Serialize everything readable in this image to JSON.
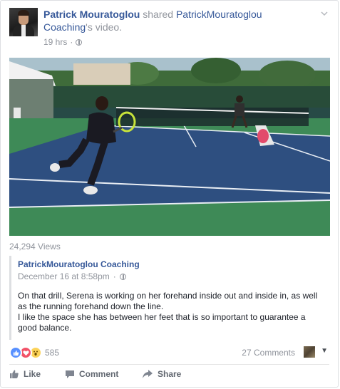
{
  "post": {
    "author": "Patrick Mouratoglou",
    "action_text": " shared ",
    "shared_page": "PatrickMouratoglou Coaching",
    "suffix": "'s video.",
    "time": "19 hrs",
    "views": "24,294 Views"
  },
  "shared_post": {
    "page_name": "PatrickMouratoglou Coaching",
    "date": "December 16 at 8:58pm",
    "text_line1": "On that drill, Serena is working on her forehand inside out and inside in, as well as the running forehand down the line.",
    "text_line2": "I like the space she has between her feet that is so important to guarantee a good balance."
  },
  "stats": {
    "reactions_count": "585",
    "comments": "27 Comments"
  },
  "actions": {
    "like": "Like",
    "comment": "Comment",
    "share": "Share"
  },
  "icons": {
    "reactions": [
      "like-reaction-icon",
      "love-reaction-icon",
      "wow-reaction-icon"
    ],
    "privacy": "globe-icon",
    "menu": "chevron-down-icon"
  },
  "colors": {
    "link": "#365899",
    "meta": "#90949c",
    "court_blue": "#2e4f80",
    "court_green": "#3e8a57"
  }
}
